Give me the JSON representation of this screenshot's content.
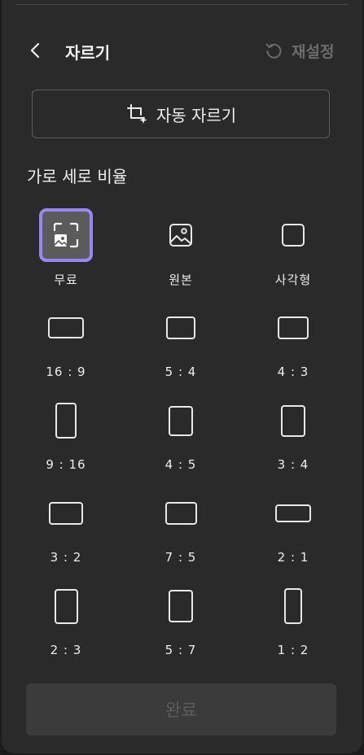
{
  "header": {
    "title": "자르기",
    "reset_label": "재설정"
  },
  "auto_crop": {
    "label": "자동 자르기"
  },
  "section": {
    "aspect_ratio_label": "가로 세로 비율"
  },
  "options": [
    {
      "label": "무료",
      "icon": "free-crop-icon",
      "selected": true
    },
    {
      "label": "원본",
      "icon": "image-icon"
    },
    {
      "label": "사각형",
      "icon": "square-icon"
    },
    {
      "label": "16 : 9"
    },
    {
      "label": "5 : 4"
    },
    {
      "label": "4 : 3"
    },
    {
      "label": "9 : 16"
    },
    {
      "label": "4 : 5"
    },
    {
      "label": "3 : 4"
    },
    {
      "label": "3 : 2"
    },
    {
      "label": "7 : 5"
    },
    {
      "label": "2 : 1"
    },
    {
      "label": "2 : 3"
    },
    {
      "label": "5 : 7"
    },
    {
      "label": "1 : 2"
    }
  ],
  "footer": {
    "done_label": "완료"
  },
  "colors": {
    "accent": "#9a86f2",
    "panel": "#2a2a2a"
  }
}
